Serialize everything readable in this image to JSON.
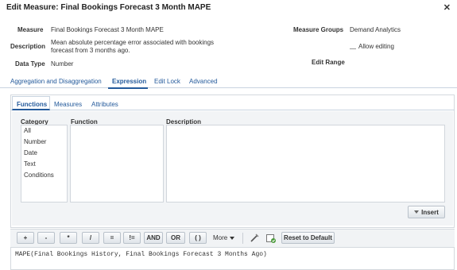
{
  "dialog": {
    "title": "Edit Measure: Final Bookings Forecast 3 Month MAPE",
    "close": "✕"
  },
  "fields": {
    "measure_label": "Measure",
    "measure_value": "Final Bookings Forecast 3 Month MAPE",
    "description_label": "Description",
    "description_value_line1": "Mean absolute percentage error associated with bookings",
    "description_value_line2": "forecast from 3 months ago.",
    "data_type_label": "Data Type",
    "data_type_value": "Number",
    "measure_groups_label": "Measure Groups",
    "measure_groups_value": "Demand Analytics",
    "allow_editing_label": "Allow editing",
    "allow_editing_checked": false,
    "edit_range_label": "Edit Range"
  },
  "main_tabs": [
    {
      "label": "Aggregation and Disaggregation",
      "active": false
    },
    {
      "label": "Expression",
      "active": true
    },
    {
      "label": "Edit Lock",
      "active": false
    },
    {
      "label": "Advanced",
      "active": false
    }
  ],
  "sub_tabs": [
    {
      "label": "Functions",
      "active": true
    },
    {
      "label": "Measures",
      "active": false
    },
    {
      "label": "Attributes",
      "active": false
    }
  ],
  "functions_panel": {
    "category_header": "Category",
    "function_header": "Function",
    "description_header": "Description",
    "categories": [
      "All",
      "Number",
      "Date",
      "Text",
      "Conditions"
    ],
    "insert_label": "Insert"
  },
  "operators": [
    "+",
    "-",
    "*",
    "/",
    "=",
    "!=",
    "AND",
    "OR",
    "( )"
  ],
  "toolbar": {
    "more_label": "More",
    "reset_label": "Reset to Default"
  },
  "expression": {
    "text": "MAPE(Final Bookings History, Final Bookings Forecast 3 Months Ago)"
  },
  "colors": {
    "link_blue": "#245a9b",
    "panel_gray": "#f2f4f6",
    "validate_green": "#4a9a3a"
  }
}
